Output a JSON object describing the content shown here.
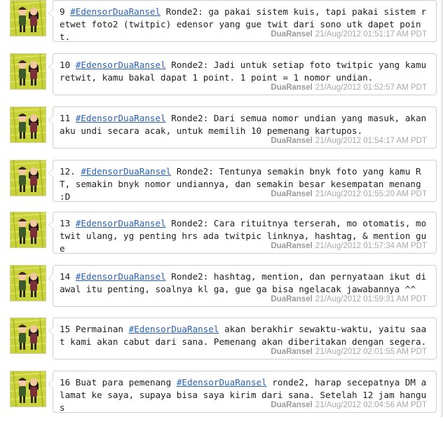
{
  "tweets": [
    {
      "pre": "9 ",
      "hashtag": "#EdensorDuaRansel",
      "post": " Ronde2: ga pakai sistem kuis, tapi pakai sistem retwet foto2 (twitpic) edensor yang gue twit dari sono utk dapet point.",
      "author": "DuaRansel",
      "timestamp": "21/Aug/2012 01:51:17 AM PDT"
    },
    {
      "pre": "10 ",
      "hashtag": "#EdensorDuaRansel",
      "post": " Ronde2: Jadi untuk setiap foto twitpic yang kamu retwit, kamu bakal dapat 1 point. 1 point = 1 nomor undian.",
      "author": "DuaRansel",
      "timestamp": "21/Aug/2012 01:52:57 AM PDT"
    },
    {
      "pre": "11 ",
      "hashtag": "#EdensorDuaRansel",
      "post": " Ronde2: Dari semua nomor undian yang masuk, akan aku undi secara acak, untuk memilih 10 pemenang kartupos.",
      "author": "DuaRansel",
      "timestamp": "21/Aug/2012 01:54:17 AM PDT"
    },
    {
      "pre": "12. ",
      "hashtag": "#EdensorDuaRansel",
      "post": " Ronde2: Tentunya semakin bnyk foto yang kamu RT, semakin bnyk nomor undiannya, dan semakin besar kesempatan menang :D",
      "author": "DuaRansel",
      "timestamp": "21/Aug/2012 01:55:20 AM PDT"
    },
    {
      "pre": "13 ",
      "hashtag": "#EdensorDuaRansel",
      "post": " Ronde2: Cara rituitnya terserah, mo otomatis, mo twit ulang, yg penting hrs ada twitpic linknya, hashtag, & mention gue",
      "author": "DuaRansel",
      "timestamp": "21/Aug/2012 01:57:34 AM PDT"
    },
    {
      "pre": "14 ",
      "hashtag": "#EdensorDuaRansel",
      "post": " Ronde2: hashtag, mention, dan pernyataan ikut di awal itu penting, soalnya kl ga, gue ga bisa ngelacak jawabannya ^^",
      "author": "DuaRansel",
      "timestamp": "21/Aug/2012 01:59:31 AM PDT"
    },
    {
      "pre": "15 Permainan ",
      "hashtag": "#EdensorDuaRansel",
      "post": " akan berakhir sewaktu-waktu, yaitu saat kami akan cabut dari sana. Pemenang akan diberitakan dengan segera.",
      "author": "DuaRansel",
      "timestamp": "21/Aug/2012 02:01:55 AM PDT"
    },
    {
      "pre": "16 Buat para pemenang ",
      "hashtag": "#EdensorDuaRansel",
      "post": " ronde2, harap secepatnya DM alamat ke saya, supaya bisa saya kirim dari sana. Setelah 12 jam hangus",
      "author": "DuaRansel",
      "timestamp": "21/Aug/2012 02:04:56 AM PDT"
    }
  ],
  "colors": {
    "hashtag": "#2a62b8",
    "meta": "#a9a9a9",
    "avatar_bg": "#c9d23a"
  }
}
